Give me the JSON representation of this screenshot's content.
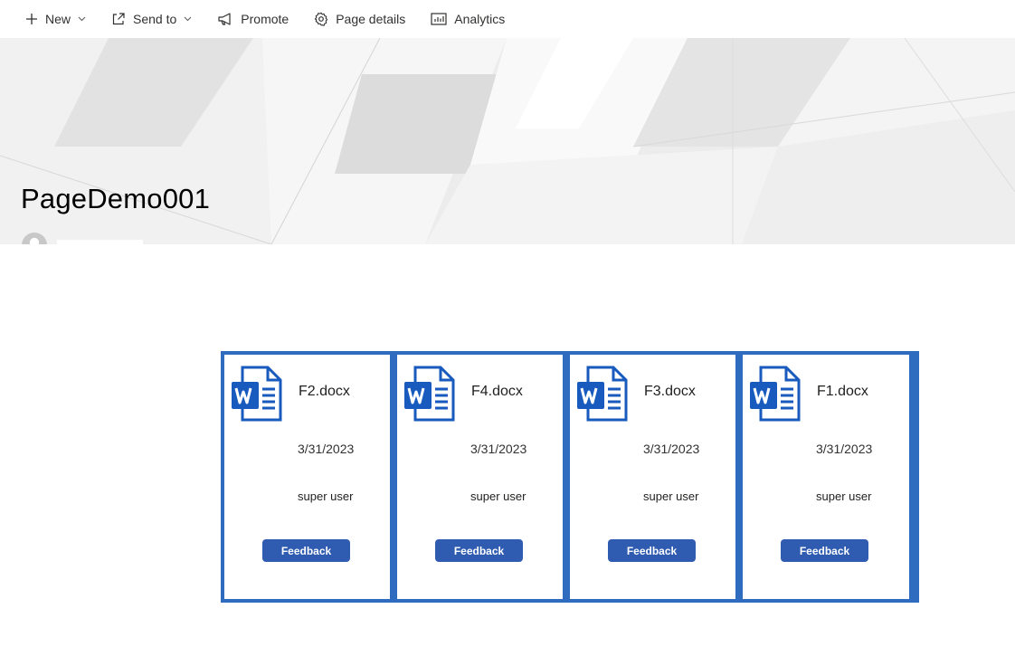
{
  "commandbar": {
    "new_label": "New",
    "sendto_label": "Send to",
    "promote_label": "Promote",
    "pagedetails_label": "Page details",
    "analytics_label": "Analytics"
  },
  "hero": {
    "title": "PageDemo001"
  },
  "cards": [
    {
      "name": "F2.docx",
      "date": "3/31/2023",
      "user": "super user",
      "button": "Feedback"
    },
    {
      "name": "F4.docx",
      "date": "3/31/2023",
      "user": "super user",
      "button": "Feedback"
    },
    {
      "name": "F3.docx",
      "date": "3/31/2023",
      "user": "super user",
      "button": "Feedback"
    },
    {
      "name": "F1.docx",
      "date": "3/31/2023",
      "user": "super user",
      "button": "Feedback"
    }
  ],
  "icons": {
    "new": "plus-icon",
    "sendto": "share-icon",
    "promote": "megaphone-icon",
    "pagedetails": "gear-icon",
    "analytics": "analytics-icon",
    "file": "word-doc-icon"
  },
  "colors": {
    "card_border": "#2f6cc0",
    "button": "#2f5bb0",
    "word_blue": "#185abd"
  }
}
